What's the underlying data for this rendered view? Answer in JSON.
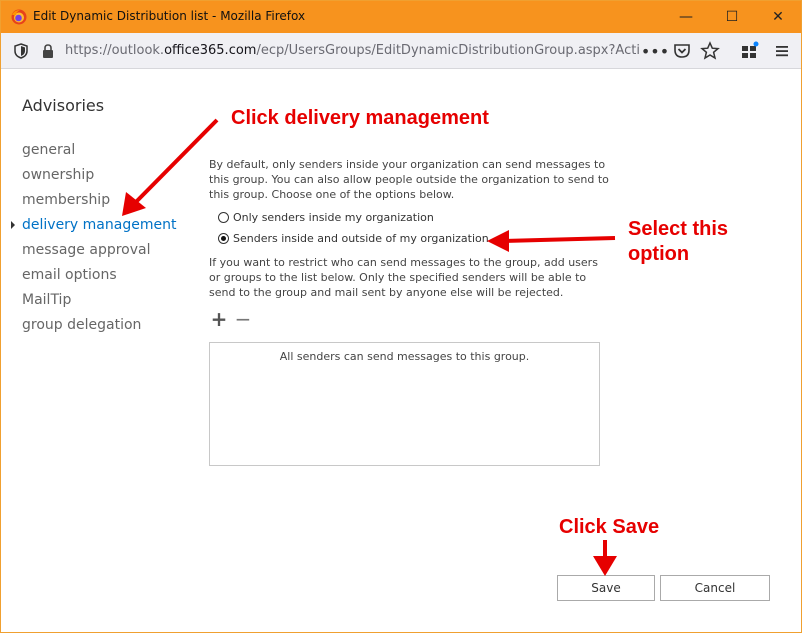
{
  "window": {
    "title": "Edit Dynamic Distribution list - Mozilla Firefox",
    "minimize_glyph": "—",
    "maximize_glyph": "☐",
    "close_glyph": "✕"
  },
  "browser": {
    "url_prefix": "https://outlook.",
    "url_domain": "office365.com",
    "url_suffix": "/ecp/UsersGroups/EditDynamicDistributionGroup.aspx?ActivityC",
    "icons": [
      "shield-icon",
      "lock-icon",
      "more-icon",
      "pocket-icon",
      "bookmark-star-icon",
      "extensions-icon",
      "menu-icon"
    ]
  },
  "page": {
    "title": "Advisories",
    "nav": [
      {
        "label": "general"
      },
      {
        "label": "ownership"
      },
      {
        "label": "membership"
      },
      {
        "label": "delivery management",
        "active": true
      },
      {
        "label": "message approval"
      },
      {
        "label": "email options"
      },
      {
        "label": "MailTip"
      },
      {
        "label": "group delegation"
      }
    ]
  },
  "delivery": {
    "intro": "By default, only senders inside your organization can send messages to this group. You can also allow people outside the organization to send to this group. Choose one of the options below.",
    "options": [
      {
        "label": "Only senders inside my organization",
        "selected": false
      },
      {
        "label": "Senders inside and outside of my organization",
        "selected": true
      }
    ],
    "restrict_text": "If you want to restrict who can send messages to the group, add users or groups to the list below. Only the specified senders will be able to send to the group and mail sent by anyone else will be rejected.",
    "add_glyph": "+",
    "remove_glyph": "−",
    "empty_list_text": "All senders can send messages to this group."
  },
  "buttons": {
    "save": "Save",
    "cancel": "Cancel"
  },
  "annotations": {
    "click_delivery": "Click delivery management",
    "select_line1": "Select this",
    "select_line2": "option",
    "click_save": "Click Save",
    "color": "#e60000"
  },
  "colors": {
    "titlebar": "#f7931e",
    "active_nav": "#0072c6"
  }
}
